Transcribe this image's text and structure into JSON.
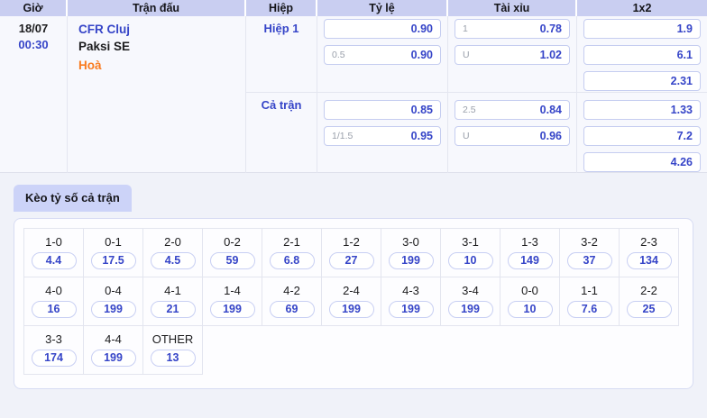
{
  "odds_table": {
    "headers": {
      "time": "Giờ",
      "match": "Trận đấu",
      "half": "Hiệp",
      "odds": "Tỷ lệ",
      "over_under": "Tài xỉu",
      "one_x_two": "1x2"
    },
    "match": {
      "date": "18/07",
      "time": "00:30",
      "home_team": "CFR Cluj",
      "away_team": "Paksi SE",
      "result": "Hoà"
    },
    "blocks": [
      {
        "label": "Hiệp 1",
        "handicap": [
          {
            "line": "",
            "odds": "0.90"
          },
          {
            "line": "0.5",
            "odds": "0.90"
          }
        ],
        "over_under": [
          {
            "line": "1",
            "odds": "0.78"
          },
          {
            "line": "U",
            "odds": "1.02"
          }
        ],
        "one_x_two": [
          "1.9",
          "6.1",
          "2.31"
        ]
      },
      {
        "label": "Cả trận",
        "handicap": [
          {
            "line": "",
            "odds": "0.85"
          },
          {
            "line": "1/1.5",
            "odds": "0.95"
          }
        ],
        "over_under": [
          {
            "line": "2.5",
            "odds": "0.84"
          },
          {
            "line": "U",
            "odds": "0.96"
          }
        ],
        "one_x_two": [
          "1.33",
          "7.2",
          "4.26"
        ]
      }
    ]
  },
  "correct_score": {
    "tab_label": "Kèo tỷ số cả trận",
    "rows": [
      {
        "cells": [
          {
            "score": "1-0",
            "odds": "4.4"
          },
          {
            "score": "0-1",
            "odds": "17.5"
          },
          {
            "score": "2-0",
            "odds": "4.5"
          },
          {
            "score": "0-2",
            "odds": "59"
          },
          {
            "score": "2-1",
            "odds": "6.8"
          },
          {
            "score": "1-2",
            "odds": "27"
          },
          {
            "score": "3-0",
            "odds": "199"
          },
          {
            "score": "3-1",
            "odds": "10"
          },
          {
            "score": "1-3",
            "odds": "149"
          },
          {
            "score": "3-2",
            "odds": "37"
          },
          {
            "score": "2-3",
            "odds": "134"
          }
        ]
      },
      {
        "cells": [
          {
            "score": "4-0",
            "odds": "16"
          },
          {
            "score": "0-4",
            "odds": "199"
          },
          {
            "score": "4-1",
            "odds": "21"
          },
          {
            "score": "1-4",
            "odds": "199"
          },
          {
            "score": "4-2",
            "odds": "69"
          },
          {
            "score": "2-4",
            "odds": "199"
          },
          {
            "score": "4-3",
            "odds": "199"
          },
          {
            "score": "3-4",
            "odds": "199"
          },
          {
            "score": "0-0",
            "odds": "10"
          },
          {
            "score": "1-1",
            "odds": "7.6"
          },
          {
            "score": "2-2",
            "odds": "25"
          }
        ]
      },
      {
        "cells": [
          {
            "score": "3-3",
            "odds": "174"
          },
          {
            "score": "4-4",
            "odds": "199"
          },
          {
            "score": "OTHER",
            "odds": "13"
          }
        ]
      }
    ]
  },
  "colors": {
    "accent_blue": "#3645c8",
    "result_orange": "#f97b1f",
    "header_bg": "#c9cef1",
    "tab_bg": "#ccd3f8"
  }
}
